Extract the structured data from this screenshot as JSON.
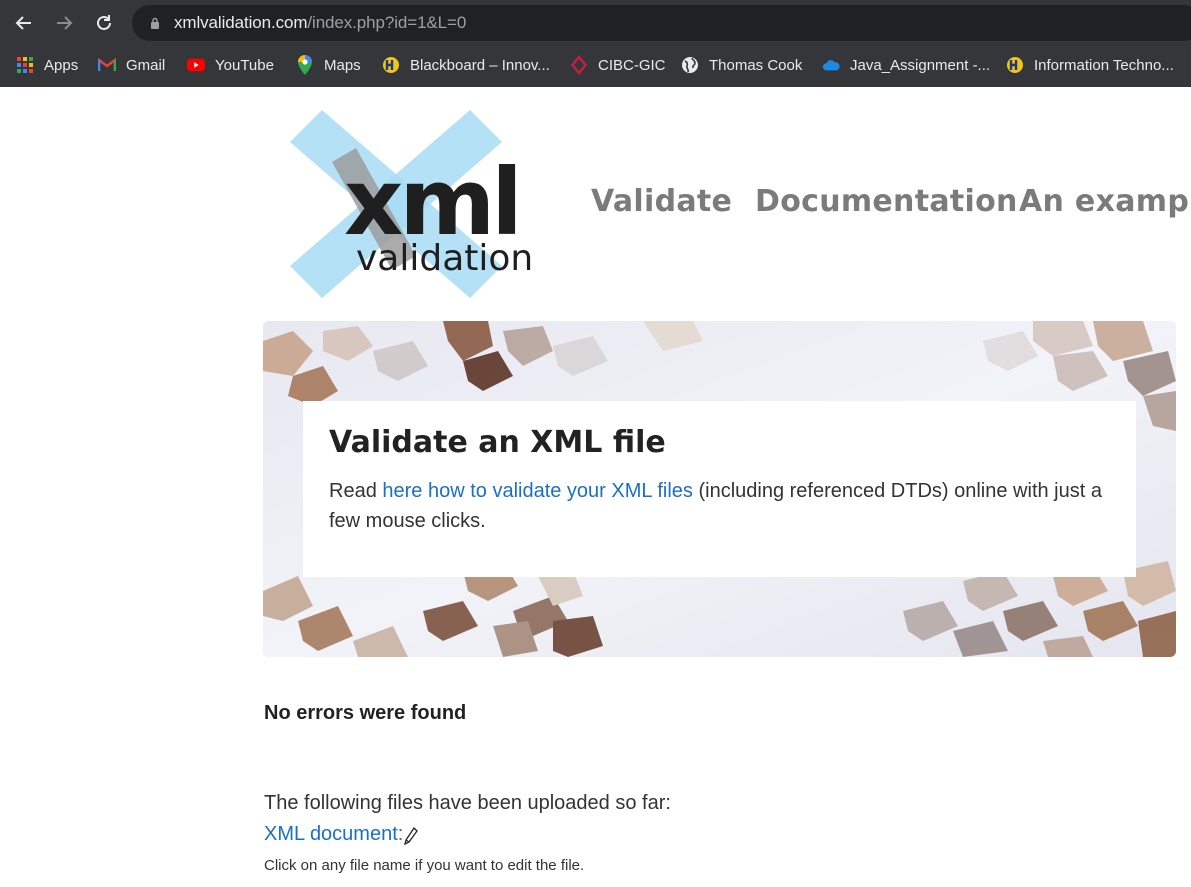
{
  "browser": {
    "url_host": "xmlvalidation.com",
    "url_path": "/index.php?id=1&L=0",
    "bookmarks": [
      {
        "label": "Apps",
        "icon": "apps-grid-icon"
      },
      {
        "label": "Gmail",
        "icon": "gmail-icon"
      },
      {
        "label": "YouTube",
        "icon": "youtube-icon"
      },
      {
        "label": "Maps",
        "icon": "maps-pin-icon"
      },
      {
        "label": "Blackboard – Innov...",
        "icon": "blackboard-icon"
      },
      {
        "label": "CIBC-GIC",
        "icon": "cibc-icon"
      },
      {
        "label": "Thomas Cook",
        "icon": "globe-icon"
      },
      {
        "label": "Java_Assignment -...",
        "icon": "onedrive-cloud-icon"
      },
      {
        "label": "Information Techno...",
        "icon": "blackboard-icon"
      }
    ]
  },
  "logo": {
    "main": "xml",
    "sub": "validation"
  },
  "nav": {
    "items": [
      "Validate",
      "Documentation",
      "An example"
    ]
  },
  "hero": {
    "title": "Validate an XML file",
    "text_before": "Read ",
    "link": "here how to validate your XML files",
    "text_after": " (including referenced DTDs) online with just a few mouse clicks."
  },
  "result": {
    "status": "No errors were found",
    "uploaded_label": "The following files have been uploaded so far:",
    "file_link": "XML document:",
    "hint": "Click on any file name if you want to edit the file."
  },
  "colors": {
    "chrome_bg": "#35363a",
    "link": "#1a6fc9",
    "nav_text": "#7b7b7b"
  }
}
